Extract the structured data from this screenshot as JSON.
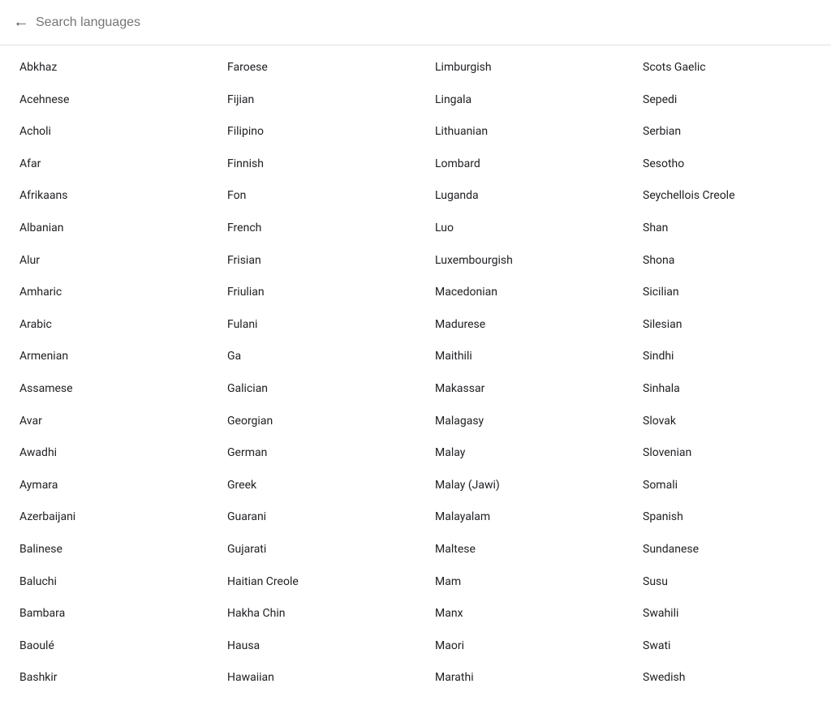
{
  "header": {
    "search_placeholder": "Search languages",
    "back_label": "←"
  },
  "columns": [
    [
      "Abkhaz",
      "Acehnese",
      "Acholi",
      "Afar",
      "Afrikaans",
      "Albanian",
      "Alur",
      "Amharic",
      "Arabic",
      "Armenian",
      "Assamese",
      "Avar",
      "Awadhi",
      "Aymara",
      "Azerbaijani",
      "Balinese",
      "Baluchi",
      "Bambara",
      "Baoulé",
      "Bashkir"
    ],
    [
      "Faroese",
      "Fijian",
      "Filipino",
      "Finnish",
      "Fon",
      "French",
      "Frisian",
      "Friulian",
      "Fulani",
      "Ga",
      "Galician",
      "Georgian",
      "German",
      "Greek",
      "Guarani",
      "Gujarati",
      "Haitian Creole",
      "Hakha Chin",
      "Hausa",
      "Hawaiian"
    ],
    [
      "Limburgish",
      "Lingala",
      "Lithuanian",
      "Lombard",
      "Luganda",
      "Luo",
      "Luxembourgish",
      "Macedonian",
      "Madurese",
      "Maithili",
      "Makassar",
      "Malagasy",
      "Malay",
      "Malay (Jawi)",
      "Malayalam",
      "Maltese",
      "Mam",
      "Manx",
      "Maori",
      "Marathi"
    ],
    [
      "Scots Gaelic",
      "Sepedi",
      "Serbian",
      "Sesotho",
      "Seychellois Creole",
      "Shan",
      "Shona",
      "Sicilian",
      "Silesian",
      "Sindhi",
      "Sinhala",
      "Slovak",
      "Slovenian",
      "Somali",
      "Spanish",
      "Sundanese",
      "Susu",
      "Swahili",
      "Swati",
      "Swedish"
    ]
  ]
}
